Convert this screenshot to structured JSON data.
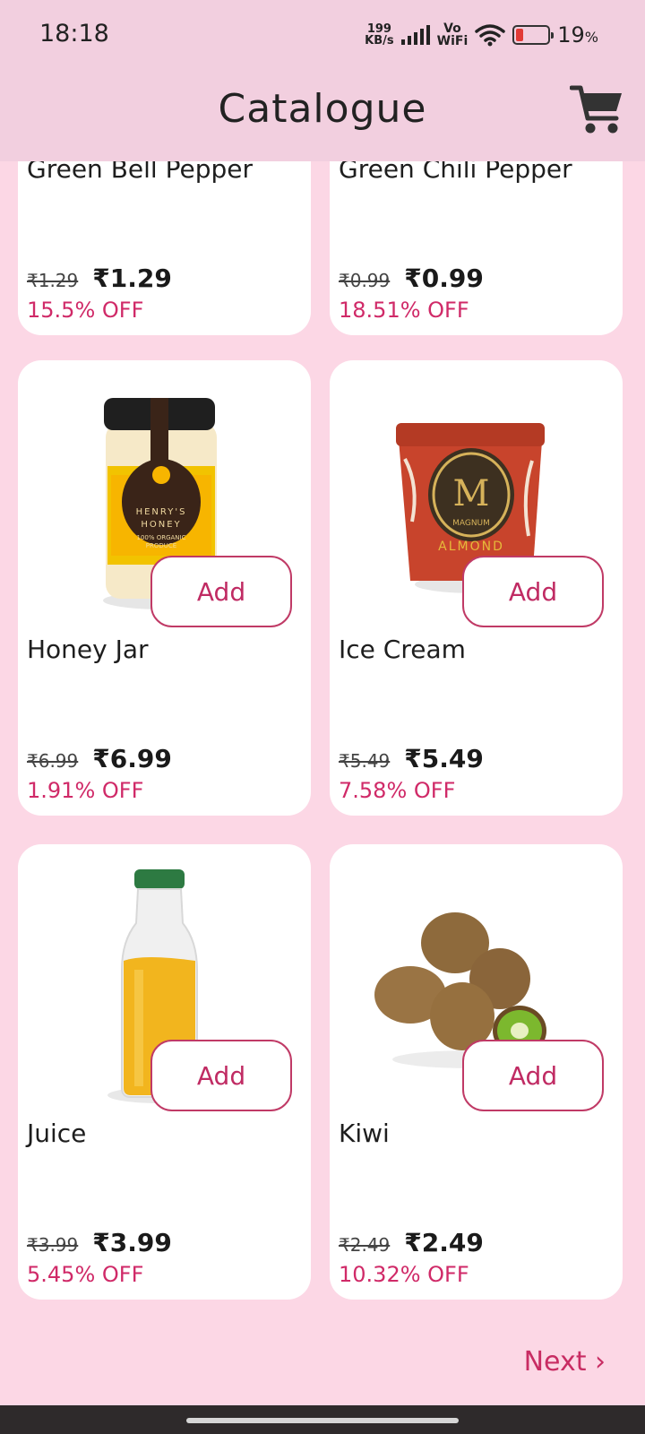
{
  "status_bar": {
    "time": "18:18",
    "net_speed_value": "199",
    "net_speed_unit": "KB/s",
    "vo_label": "Vo",
    "wifi_label": "WiFi",
    "battery_percent": "19",
    "battery_unit": "%"
  },
  "header": {
    "title": "Catalogue",
    "cart_icon": "cart-icon"
  },
  "products": [
    {
      "name": "Green Bell Pepper",
      "old_price": "₹1.29",
      "price": "₹1.29",
      "discount": "15.5% OFF"
    },
    {
      "name": "Green Chili Pepper",
      "old_price": "₹0.99",
      "price": "₹0.99",
      "discount": "18.51% OFF"
    },
    {
      "name": "Honey Jar",
      "old_price": "₹6.99",
      "price": "₹6.99",
      "discount": "1.91% OFF",
      "add_label": "Add",
      "image_text_1": "HENRY'S",
      "image_text_2": "HONEY",
      "image_text_3": "100% ORGANIC",
      "image_text_4": "PRODUCE"
    },
    {
      "name": "Ice Cream",
      "old_price": "₹5.49",
      "price": "₹5.49",
      "discount": "7.58% OFF",
      "add_label": "Add",
      "image_text_1": "M",
      "image_text_2": "MAGNUM",
      "image_text_3": "ALMOND"
    },
    {
      "name": "Juice",
      "old_price": "₹3.99",
      "price": "₹3.99",
      "discount": "5.45% OFF",
      "add_label": "Add"
    },
    {
      "name": "Kiwi",
      "old_price": "₹2.49",
      "price": "₹2.49",
      "discount": "10.32% OFF",
      "add_label": "Add"
    }
  ],
  "pagination": {
    "next_label": "Next ›"
  },
  "colors": {
    "background": "#fcd7e5",
    "app_bar": "#f2cfdf",
    "accent": "#c82c63"
  }
}
